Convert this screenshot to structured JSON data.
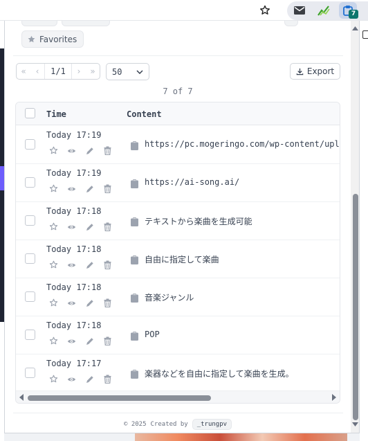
{
  "browser": {
    "extension_badge": "7",
    "icons": [
      "star-outline-icon",
      "mail-icon",
      "chart-icon",
      "clipboard-extension-icon"
    ]
  },
  "filters": {
    "favorites_label": "Favorites"
  },
  "pagination": {
    "first": "«",
    "prev": "‹",
    "page_label": "1/1",
    "next": "›",
    "last": "»",
    "per_page": "50",
    "export_label": "Export",
    "count_text": "7 of 7"
  },
  "table": {
    "columns": [
      "Time",
      "Content"
    ],
    "rows": [
      {
        "time": "Today 17:19",
        "content": "https://pc.mogeringo.com/wp-content/uploads"
      },
      {
        "time": "Today 17:19",
        "content": "https://ai-song.ai/"
      },
      {
        "time": "Today 17:18",
        "content": "テキストから楽曲を生成可能"
      },
      {
        "time": "Today 17:18",
        "content": "自由に指定して楽曲"
      },
      {
        "time": "Today 17:18",
        "content": "音楽ジャンル"
      },
      {
        "time": "Today 17:18",
        "content": "POP"
      },
      {
        "time": "Today 17:17",
        "content": "楽器などを自由に指定して楽曲を生成。"
      }
    ]
  },
  "footer": {
    "copyright": "© 2025",
    "created_by": "Created by",
    "author": "_trungpv"
  },
  "colors": {
    "badge": "#0f766e",
    "icon_gray": "#9ca3af",
    "scroll_thumb": "#8a8f98"
  }
}
